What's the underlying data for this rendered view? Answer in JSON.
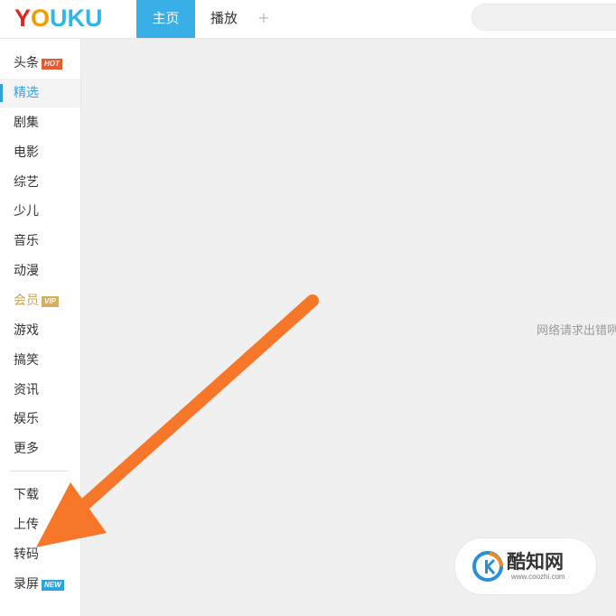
{
  "header": {
    "logo_text": "YOUKU",
    "logo_colors": [
      "#e1251b",
      "#f49b00",
      "#2eb6e8",
      "#2eb6e8",
      "#2eb6e8"
    ],
    "tabs": [
      {
        "label": "主页",
        "active": true
      },
      {
        "label": "播放",
        "active": false
      }
    ],
    "add_tab_label": "+",
    "accent_color": "#3aaee6"
  },
  "sidebar": {
    "items": [
      {
        "label": "头条",
        "badge": "HOT"
      },
      {
        "label": "精选",
        "active": true
      },
      {
        "label": "剧集"
      },
      {
        "label": "电影"
      },
      {
        "label": "综艺"
      },
      {
        "label": "少儿"
      },
      {
        "label": "音乐"
      },
      {
        "label": "动漫"
      },
      {
        "label": "会员",
        "badge": "VIP"
      },
      {
        "label": "游戏"
      },
      {
        "label": "搞笑"
      },
      {
        "label": "资讯"
      },
      {
        "label": "娱乐"
      },
      {
        "label": "更多"
      }
    ],
    "tools": [
      {
        "label": "下载"
      },
      {
        "label": "上传"
      },
      {
        "label": "转码"
      },
      {
        "label": "录屏",
        "badge": "NEW"
      }
    ]
  },
  "main": {
    "error_message": "网络请求出错咧"
  },
  "watermark": {
    "title": "酷知网",
    "url": "www.coozhi.com"
  },
  "annotation": {
    "arrow_color": "#f7772a"
  }
}
